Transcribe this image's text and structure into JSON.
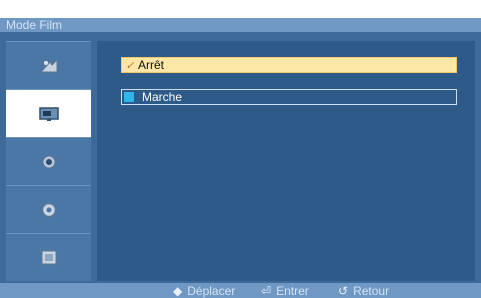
{
  "header": {
    "title": "Mode Film"
  },
  "sidebar": {
    "items": [
      {
        "icon": "picture-settings-icon",
        "selected": false
      },
      {
        "icon": "screen-icon",
        "selected": true
      },
      {
        "icon": "sound-icon",
        "selected": false
      },
      {
        "icon": "setup-icon",
        "selected": false
      },
      {
        "icon": "multi-control-icon",
        "selected": false
      }
    ]
  },
  "options": [
    {
      "label": "Arrêt",
      "check": "✓",
      "selected": true
    },
    {
      "label": "Marche",
      "selected": false
    }
  ],
  "footer": {
    "move_icon": "◆",
    "move_label": "Déplacer",
    "enter_icon": "⏎",
    "enter_label": "Entrer",
    "back_icon": "↺",
    "back_label": "Retour"
  },
  "colors": {
    "panel": "#3d6a99",
    "main": "#2e5a89",
    "highlight": "#fde7a6",
    "accent": "#31b2ea"
  }
}
